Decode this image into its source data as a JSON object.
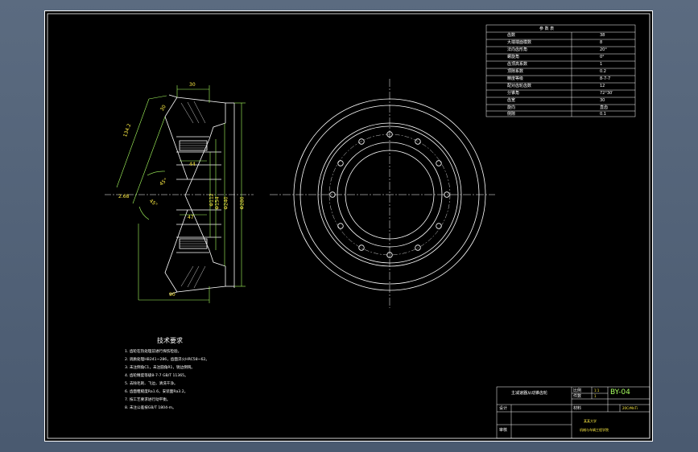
{
  "drawing": {
    "notes_title": "技术要求",
    "notes": [
      "1. 齿轮在热处理前进行探伤检验。",
      "2. 调质处理HB241~286，齿面淬火HRC58~62。",
      "3. 未注倒角C1，未注圆角R1，锐边倒钝。",
      "4. 齿轮精度等级8-7-7 GB/T 11365。",
      "5. 去除毛刺、飞边，清洗干净。",
      "6. 齿面粗糙度Ra1.6，安装面Ra3.2。",
      "7. 按工艺要求进行动平衡。",
      "8. 未注公差按GB/T 1804-m。"
    ],
    "dims": {
      "top_width": "30",
      "left_slant": "134.2",
      "bevel": "30",
      "inner_a": "44",
      "inner_b": "47",
      "bottom_width": "90",
      "angle_a": "45°",
      "angle_b": "45°",
      "offset": "2.68",
      "dia_1": "Φ112",
      "dia_2": "Φ154",
      "dia_3": "Φ240",
      "dia_4": "Φ280"
    },
    "param_table": {
      "title": "参 数 表",
      "rows": [
        {
          "name": "齿数",
          "value": "38"
        },
        {
          "name": "大端端面模数",
          "value": "8"
        },
        {
          "name": "法向齿形角",
          "value": "20°"
        },
        {
          "name": "螺旋角",
          "value": "0°"
        },
        {
          "name": "齿顶高系数",
          "value": "1"
        },
        {
          "name": "顶隙系数",
          "value": "0.2"
        },
        {
          "name": "精度等级",
          "value": "8-7-7"
        },
        {
          "name": "配对齿轮齿数",
          "value": "12"
        },
        {
          "name": "分锥角",
          "value": "72°30′"
        },
        {
          "name": "齿宽",
          "value": "30"
        },
        {
          "name": "旋向",
          "value": "直齿"
        },
        {
          "name": "侧隙",
          "value": "0.1"
        }
      ]
    },
    "title_block": {
      "part_name": "主减速器从动锥齿轮",
      "drawing_no": "BY-04",
      "scale_label": "比例",
      "scale_value": "1:1",
      "qty_label": "件数",
      "qty_value": "1",
      "material_label": "材料",
      "material_value": "20CrMnTi",
      "designer_label": "设计",
      "checker_label": "审核",
      "school": "某某大学",
      "dept": "机械与车辆工程学院"
    }
  },
  "colors": {
    "background": "#000000",
    "frame": "#ffffff",
    "outline": "#ffffff",
    "dimension": "#a8ff60",
    "dim_text": "#ffee44",
    "accent_yellow": "#ffee44"
  }
}
